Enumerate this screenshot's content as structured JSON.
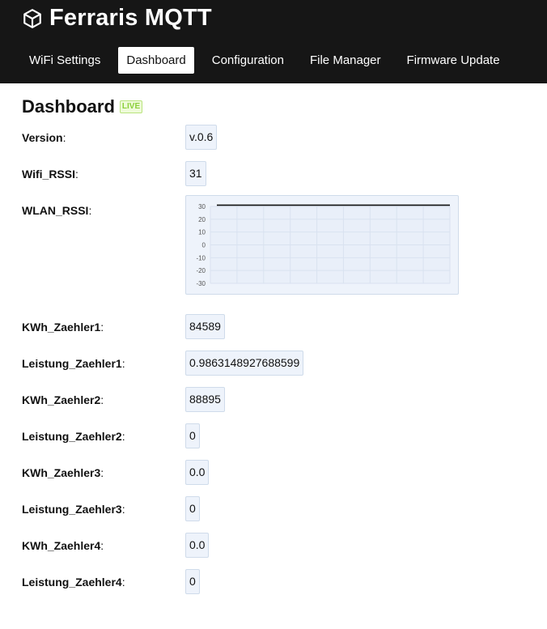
{
  "app": {
    "title": "Ferraris MQTT",
    "icon": "cube-icon"
  },
  "nav": [
    {
      "label": "WiFi Settings",
      "active": false
    },
    {
      "label": "Dashboard",
      "active": true
    },
    {
      "label": "Configuration",
      "active": false
    },
    {
      "label": "File Manager",
      "active": false
    },
    {
      "label": "Firmware Update",
      "active": false
    }
  ],
  "page": {
    "title": "Dashboard",
    "badge": "LIVE"
  },
  "fields": {
    "version": {
      "label": "Version",
      "value": "v.0.6"
    },
    "wifi_rssi": {
      "label": "Wifi_RSSI",
      "value": "31"
    },
    "wlan_rssi": {
      "label": "WLAN_RSSI"
    },
    "kwh1": {
      "label": "KWh_Zaehler1",
      "value": "84589"
    },
    "leistung1": {
      "label": "Leistung_Zaehler1",
      "value": "0.9863148927688599"
    },
    "kwh2": {
      "label": "KWh_Zaehler2",
      "value": "88895"
    },
    "leistung2": {
      "label": "Leistung_Zaehler2",
      "value": "0"
    },
    "kwh3": {
      "label": "KWh_Zaehler3",
      "value": "0.0"
    },
    "leistung3": {
      "label": "Leistung_Zaehler3",
      "value": "0"
    },
    "kwh4": {
      "label": "KWh_Zaehler4",
      "value": "0.0"
    },
    "leistung4": {
      "label": "Leistung_Zaehler4",
      "value": "0"
    }
  },
  "colors": {
    "topbar": "#161616",
    "value_bg": "#eef3fb",
    "live": "#8bcf3a"
  },
  "chart_data": {
    "type": "line",
    "title": "",
    "xlabel": "",
    "ylabel": "",
    "yticks": [
      "30",
      "20",
      "10",
      "0",
      "-10",
      "-20",
      "-30"
    ],
    "ylim": [
      -30,
      30
    ],
    "grid": true,
    "series": [
      {
        "values": [
          31,
          31
        ]
      }
    ]
  }
}
